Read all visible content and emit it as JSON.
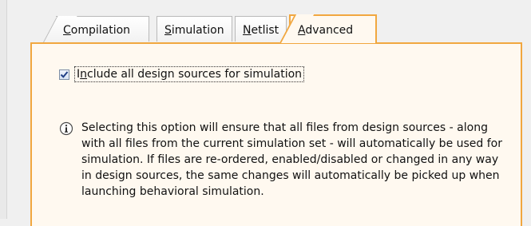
{
  "tabs": [
    {
      "label_pre": "",
      "label_key": "C",
      "label_post": "ompilation"
    },
    {
      "label_pre": "",
      "label_key": "S",
      "label_post": "imulation"
    },
    {
      "label_pre": "",
      "label_key": "N",
      "label_post": "etlist"
    },
    {
      "label_pre": "",
      "label_key": "A",
      "label_post": "dvanced"
    }
  ],
  "active_tab": "Advanced",
  "option": {
    "checked": true,
    "label_pre": "I",
    "label_key": "n",
    "label_post": "clude all design sources for simulation"
  },
  "info": {
    "icon": "info-icon",
    "text": "Selecting this option will ensure that all files from design sources - along with all files from the current simulation set - will automatically be used for simulation. If files are re-ordered, enabled/disabled or changed in any way in design sources, the same changes will automatically be picked up when launching behavioral simulation."
  },
  "colors": {
    "accent": "#f1a73f",
    "panel_bg": "#fff9f0"
  }
}
